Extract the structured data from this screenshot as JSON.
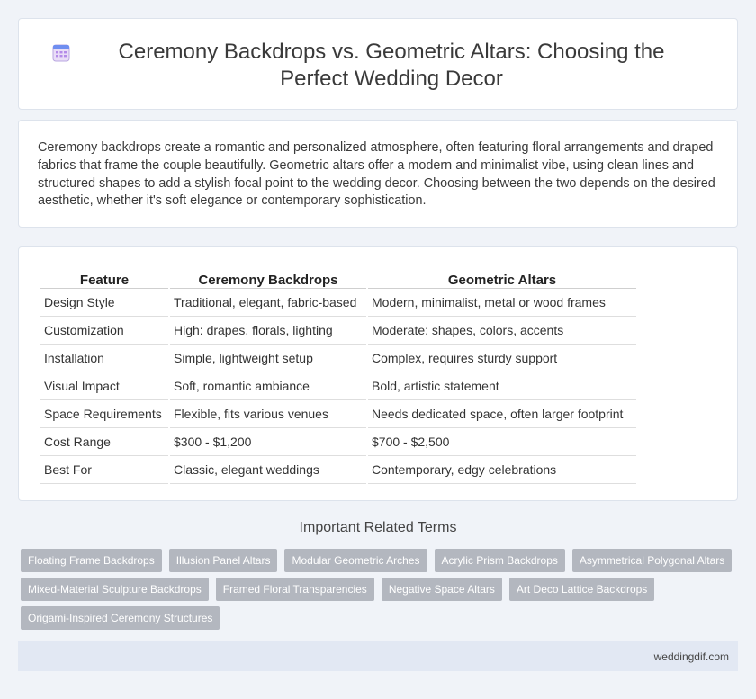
{
  "header": {
    "title": "Ceremony Backdrops vs. Geometric Altars: Choosing the Perfect Wedding Decor",
    "icon": "calendar-icon"
  },
  "intro": {
    "text": "Ceremony backdrops create a romantic and personalized atmosphere, often featuring floral arrangements and draped fabrics that frame the couple beautifully. Geometric altars offer a modern and minimalist vibe, using clean lines and structured shapes to add a stylish focal point to the wedding decor. Choosing between the two depends on the desired aesthetic, whether it's soft elegance or contemporary sophistication."
  },
  "table": {
    "headers": [
      "Feature",
      "Ceremony Backdrops",
      "Geometric Altars"
    ],
    "rows": [
      [
        "Design Style",
        "Traditional, elegant, fabric-based",
        "Modern, minimalist, metal or wood frames"
      ],
      [
        "Customization",
        "High: drapes, florals, lighting",
        "Moderate: shapes, colors, accents"
      ],
      [
        "Installation",
        "Simple, lightweight setup",
        "Complex, requires sturdy support"
      ],
      [
        "Visual Impact",
        "Soft, romantic ambiance",
        "Bold, artistic statement"
      ],
      [
        "Space Requirements",
        "Flexible, fits various venues",
        "Needs dedicated space, often larger footprint"
      ],
      [
        "Cost Range",
        "$300 - $1,200",
        "$700 - $2,500"
      ],
      [
        "Best For",
        "Classic, elegant weddings",
        "Contemporary, edgy celebrations"
      ]
    ]
  },
  "related": {
    "title": "Important Related Terms",
    "tags": [
      "Floating Frame Backdrops",
      "Illusion Panel Altars",
      "Modular Geometric Arches",
      "Acrylic Prism Backdrops",
      "Asymmetrical Polygonal Altars",
      "Mixed-Material Sculpture Backdrops",
      "Framed Floral Transparencies",
      "Negative Space Altars",
      "Art Deco Lattice Backdrops",
      "Origami-Inspired Ceremony Structures"
    ]
  },
  "footer": {
    "site": "weddingdif.com"
  },
  "colors": {
    "background": "#f0f3f8",
    "tag": "#b3b7bf",
    "footer": "#e2e8f3"
  }
}
